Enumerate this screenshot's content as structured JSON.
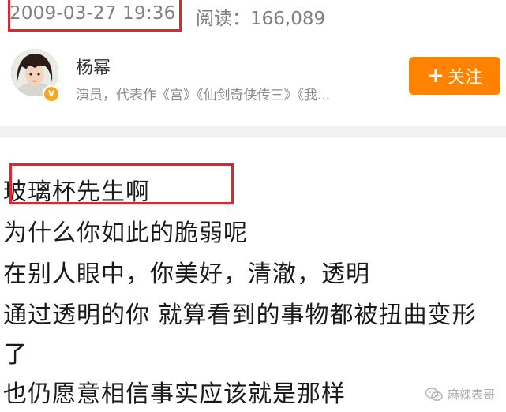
{
  "post": {
    "timestamp": "2009-03-27 19:36",
    "read_label": "阅读：",
    "read_count": "166,089"
  },
  "author": {
    "name": "杨幂",
    "description": "演员，代表作《宫》《仙剑奇侠传三》《我...",
    "verified_badge": "v",
    "follow_plus": "+",
    "follow_label": "关注"
  },
  "content": {
    "lines": [
      "玻璃杯先生啊",
      "为什么你如此的脆弱呢",
      "在别人眼中，你美好，清澈，透明",
      "通过透明的你 就算看到的事物都被扭曲变形",
      "了",
      "也仍愿意相信事实应该就是那样"
    ]
  },
  "watermark": {
    "text": "麻辣表哥"
  },
  "colors": {
    "highlight_box": "#e3242b",
    "follow_button": "#ff8200",
    "verified_badge": "#f5a623"
  }
}
